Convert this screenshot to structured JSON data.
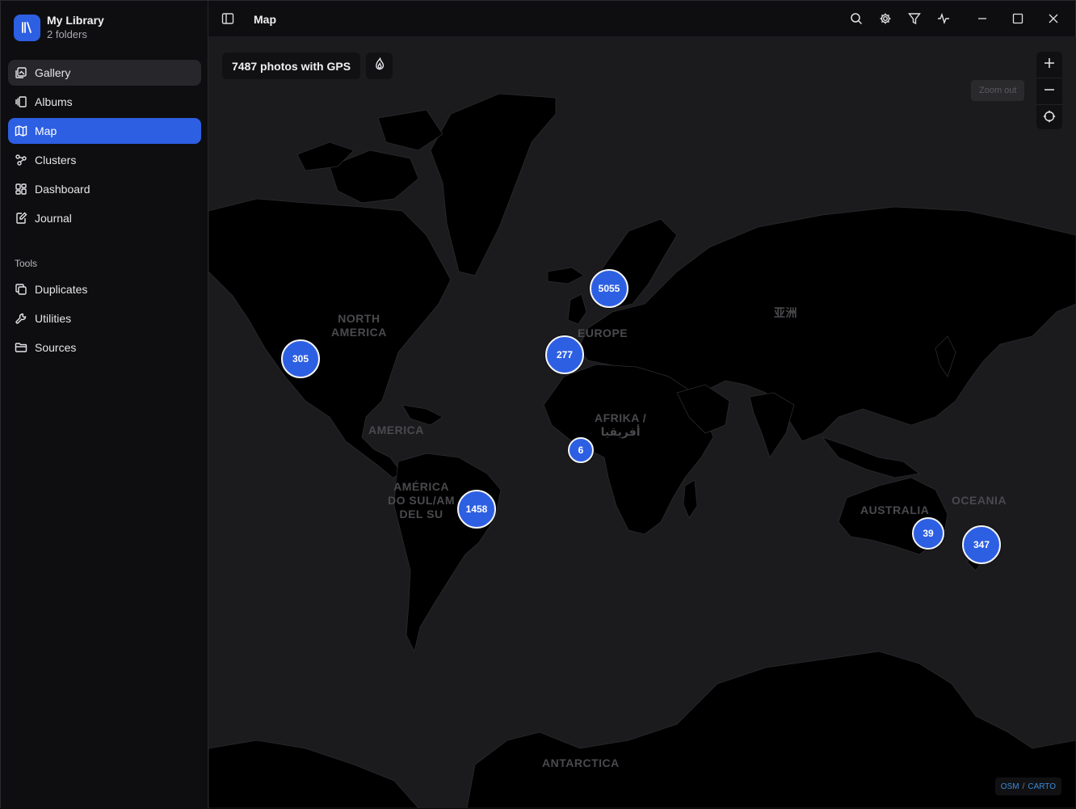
{
  "library": {
    "title": "My Library",
    "subtitle": "2 folders"
  },
  "nav": [
    {
      "label": "Gallery",
      "icon": "gallery-icon",
      "state": "hover"
    },
    {
      "label": "Albums",
      "icon": "albums-icon",
      "state": ""
    },
    {
      "label": "Map",
      "icon": "map-icon",
      "state": "active"
    },
    {
      "label": "Clusters",
      "icon": "clusters-icon",
      "state": ""
    },
    {
      "label": "Dashboard",
      "icon": "dashboard-icon",
      "state": ""
    },
    {
      "label": "Journal",
      "icon": "journal-icon",
      "state": ""
    }
  ],
  "tools_label": "Tools",
  "tools": [
    {
      "label": "Duplicates",
      "icon": "duplicates-icon"
    },
    {
      "label": "Utilities",
      "icon": "wrench-icon"
    },
    {
      "label": "Sources",
      "icon": "folder-icon"
    }
  ],
  "titlebar": {
    "title": "Map"
  },
  "map": {
    "gps_count": "7487 photos with GPS",
    "zoom_tooltip": "Zoom out",
    "attribution": {
      "osm": "OSM",
      "sep": "/",
      "carto": "CARTO"
    },
    "labels": {
      "north_america": "NORTH\nAMERICA",
      "america": "AMERICA",
      "south_america": "AMÉRICA\nDO SUL/AM\nDEL SU",
      "europe": "EUROPE",
      "africa": "AFRIKA /\nأفريقيا",
      "asia": "亚洲",
      "australia": "AUSTRALIA",
      "oceania": "OCEANIA",
      "antarctica": "ANTARCTICA"
    },
    "clusters": [
      {
        "count": "5055",
        "region": "europe-north"
      },
      {
        "count": "305",
        "region": "north-america"
      },
      {
        "count": "277",
        "region": "iberia"
      },
      {
        "count": "6",
        "region": "west-africa"
      },
      {
        "count": "1458",
        "region": "south-america"
      },
      {
        "count": "39",
        "region": "australia"
      },
      {
        "count": "347",
        "region": "new-zealand"
      }
    ]
  },
  "colors": {
    "accent": "#2d5fe3",
    "land": "#000000",
    "ocean": "#1b1b1d",
    "sidebar": "#0e0e10"
  }
}
